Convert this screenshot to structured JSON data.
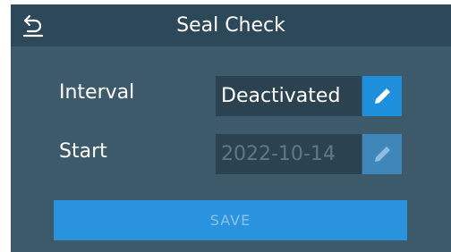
{
  "header": {
    "title": "Seal Check",
    "back_icon": "back-arrow-icon"
  },
  "rows": {
    "interval": {
      "label": "Interval",
      "value": "Deactivated",
      "edit_icon": "pencil-icon"
    },
    "start": {
      "label": "Start",
      "value": "2022-10-14",
      "edit_icon": "pencil-icon"
    }
  },
  "actions": {
    "save_label": "SAVE"
  },
  "colors": {
    "screen_bg": "#3d5a6b",
    "header_bg": "#2d4858",
    "field_bg": "#2b4350",
    "accent": "#1e8fdc"
  }
}
